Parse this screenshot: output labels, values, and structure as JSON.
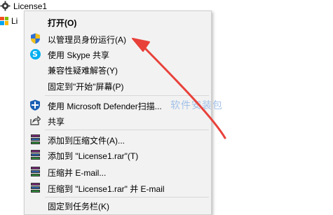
{
  "desktop": {
    "file1_label": "License1",
    "file2_label_partial": "Li"
  },
  "context_menu": {
    "items": [
      {
        "label": "打开(O)",
        "icon": "none",
        "bold": true
      },
      {
        "label": "以管理员身份运行(A)",
        "icon": "uac-shield-icon"
      },
      {
        "label": "使用 Skype 共享",
        "icon": "skype-icon"
      },
      {
        "label": "兼容性疑难解答(Y)",
        "icon": "none"
      },
      {
        "label": "固定到\"开始\"屏幕(P)",
        "icon": "none"
      },
      {
        "label": "使用 Microsoft Defender扫描...",
        "icon": "defender-icon"
      },
      {
        "label": "共享",
        "icon": "share-icon"
      },
      {
        "label": "添加到压缩文件(A)...",
        "icon": "winrar-icon"
      },
      {
        "label": "添加到 \"License1.rar\"(T)",
        "icon": "winrar-icon"
      },
      {
        "label": "压缩并 E-mail...",
        "icon": "winrar-icon"
      },
      {
        "label": "压缩到 \"License1.rar\" 并 E-mail",
        "icon": "winrar-icon"
      },
      {
        "label": "固定到任务栏(K)",
        "icon": "none"
      }
    ]
  },
  "watermark": "软件安装包",
  "colors": {
    "menu_bg": "#f2f2f2",
    "arrow": "#e8413a",
    "skype": "#00aff0",
    "defender": "#1a5fb4"
  }
}
